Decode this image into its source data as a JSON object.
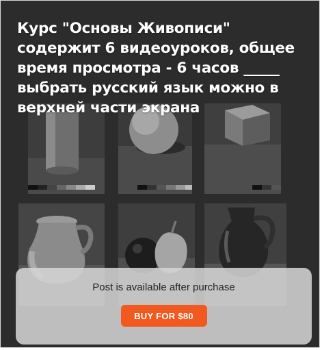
{
  "post": {
    "headline": "Курс \"Основы Живописи\" содержит 6 видеоуроков, общее время просмотра - 6 часов _____ выбрать русский язык можно в верхней части экрана"
  },
  "paywall": {
    "message": "Post is available after purchase",
    "buy_label": "BUY FOR $80",
    "button_color": "#f2591f"
  },
  "gallery": {
    "items": [
      "cylinder-study",
      "sphere-study",
      "cube-study",
      "jug-study",
      "apple-study",
      "pitcher-study"
    ]
  }
}
